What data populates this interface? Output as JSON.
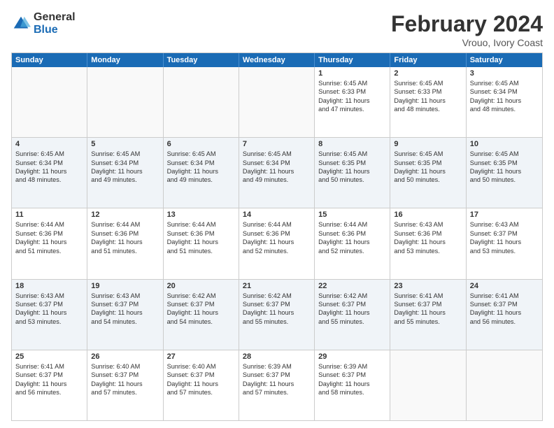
{
  "logo": {
    "general": "General",
    "blue": "Blue"
  },
  "header": {
    "month": "February 2024",
    "location": "Vrouo, Ivory Coast"
  },
  "days": [
    "Sunday",
    "Monday",
    "Tuesday",
    "Wednesday",
    "Thursday",
    "Friday",
    "Saturday"
  ],
  "rows": [
    [
      {
        "num": "",
        "lines": [],
        "empty": true
      },
      {
        "num": "",
        "lines": [],
        "empty": true
      },
      {
        "num": "",
        "lines": [],
        "empty": true
      },
      {
        "num": "",
        "lines": [],
        "empty": true
      },
      {
        "num": "1",
        "lines": [
          "Sunrise: 6:45 AM",
          "Sunset: 6:33 PM",
          "Daylight: 11 hours",
          "and 47 minutes."
        ]
      },
      {
        "num": "2",
        "lines": [
          "Sunrise: 6:45 AM",
          "Sunset: 6:33 PM",
          "Daylight: 11 hours",
          "and 48 minutes."
        ]
      },
      {
        "num": "3",
        "lines": [
          "Sunrise: 6:45 AM",
          "Sunset: 6:34 PM",
          "Daylight: 11 hours",
          "and 48 minutes."
        ]
      }
    ],
    [
      {
        "num": "4",
        "lines": [
          "Sunrise: 6:45 AM",
          "Sunset: 6:34 PM",
          "Daylight: 11 hours",
          "and 48 minutes."
        ]
      },
      {
        "num": "5",
        "lines": [
          "Sunrise: 6:45 AM",
          "Sunset: 6:34 PM",
          "Daylight: 11 hours",
          "and 49 minutes."
        ]
      },
      {
        "num": "6",
        "lines": [
          "Sunrise: 6:45 AM",
          "Sunset: 6:34 PM",
          "Daylight: 11 hours",
          "and 49 minutes."
        ]
      },
      {
        "num": "7",
        "lines": [
          "Sunrise: 6:45 AM",
          "Sunset: 6:34 PM",
          "Daylight: 11 hours",
          "and 49 minutes."
        ]
      },
      {
        "num": "8",
        "lines": [
          "Sunrise: 6:45 AM",
          "Sunset: 6:35 PM",
          "Daylight: 11 hours",
          "and 50 minutes."
        ]
      },
      {
        "num": "9",
        "lines": [
          "Sunrise: 6:45 AM",
          "Sunset: 6:35 PM",
          "Daylight: 11 hours",
          "and 50 minutes."
        ]
      },
      {
        "num": "10",
        "lines": [
          "Sunrise: 6:45 AM",
          "Sunset: 6:35 PM",
          "Daylight: 11 hours",
          "and 50 minutes."
        ]
      }
    ],
    [
      {
        "num": "11",
        "lines": [
          "Sunrise: 6:44 AM",
          "Sunset: 6:36 PM",
          "Daylight: 11 hours",
          "and 51 minutes."
        ]
      },
      {
        "num": "12",
        "lines": [
          "Sunrise: 6:44 AM",
          "Sunset: 6:36 PM",
          "Daylight: 11 hours",
          "and 51 minutes."
        ]
      },
      {
        "num": "13",
        "lines": [
          "Sunrise: 6:44 AM",
          "Sunset: 6:36 PM",
          "Daylight: 11 hours",
          "and 51 minutes."
        ]
      },
      {
        "num": "14",
        "lines": [
          "Sunrise: 6:44 AM",
          "Sunset: 6:36 PM",
          "Daylight: 11 hours",
          "and 52 minutes."
        ]
      },
      {
        "num": "15",
        "lines": [
          "Sunrise: 6:44 AM",
          "Sunset: 6:36 PM",
          "Daylight: 11 hours",
          "and 52 minutes."
        ]
      },
      {
        "num": "16",
        "lines": [
          "Sunrise: 6:43 AM",
          "Sunset: 6:36 PM",
          "Daylight: 11 hours",
          "and 53 minutes."
        ]
      },
      {
        "num": "17",
        "lines": [
          "Sunrise: 6:43 AM",
          "Sunset: 6:37 PM",
          "Daylight: 11 hours",
          "and 53 minutes."
        ]
      }
    ],
    [
      {
        "num": "18",
        "lines": [
          "Sunrise: 6:43 AM",
          "Sunset: 6:37 PM",
          "Daylight: 11 hours",
          "and 53 minutes."
        ]
      },
      {
        "num": "19",
        "lines": [
          "Sunrise: 6:43 AM",
          "Sunset: 6:37 PM",
          "Daylight: 11 hours",
          "and 54 minutes."
        ]
      },
      {
        "num": "20",
        "lines": [
          "Sunrise: 6:42 AM",
          "Sunset: 6:37 PM",
          "Daylight: 11 hours",
          "and 54 minutes."
        ]
      },
      {
        "num": "21",
        "lines": [
          "Sunrise: 6:42 AM",
          "Sunset: 6:37 PM",
          "Daylight: 11 hours",
          "and 55 minutes."
        ]
      },
      {
        "num": "22",
        "lines": [
          "Sunrise: 6:42 AM",
          "Sunset: 6:37 PM",
          "Daylight: 11 hours",
          "and 55 minutes."
        ]
      },
      {
        "num": "23",
        "lines": [
          "Sunrise: 6:41 AM",
          "Sunset: 6:37 PM",
          "Daylight: 11 hours",
          "and 55 minutes."
        ]
      },
      {
        "num": "24",
        "lines": [
          "Sunrise: 6:41 AM",
          "Sunset: 6:37 PM",
          "Daylight: 11 hours",
          "and 56 minutes."
        ]
      }
    ],
    [
      {
        "num": "25",
        "lines": [
          "Sunrise: 6:41 AM",
          "Sunset: 6:37 PM",
          "Daylight: 11 hours",
          "and 56 minutes."
        ]
      },
      {
        "num": "26",
        "lines": [
          "Sunrise: 6:40 AM",
          "Sunset: 6:37 PM",
          "Daylight: 11 hours",
          "and 57 minutes."
        ]
      },
      {
        "num": "27",
        "lines": [
          "Sunrise: 6:40 AM",
          "Sunset: 6:37 PM",
          "Daylight: 11 hours",
          "and 57 minutes."
        ]
      },
      {
        "num": "28",
        "lines": [
          "Sunrise: 6:39 AM",
          "Sunset: 6:37 PM",
          "Daylight: 11 hours",
          "and 57 minutes."
        ]
      },
      {
        "num": "29",
        "lines": [
          "Sunrise: 6:39 AM",
          "Sunset: 6:37 PM",
          "Daylight: 11 hours",
          "and 58 minutes."
        ]
      },
      {
        "num": "",
        "lines": [],
        "empty": true
      },
      {
        "num": "",
        "lines": [],
        "empty": true
      }
    ]
  ]
}
